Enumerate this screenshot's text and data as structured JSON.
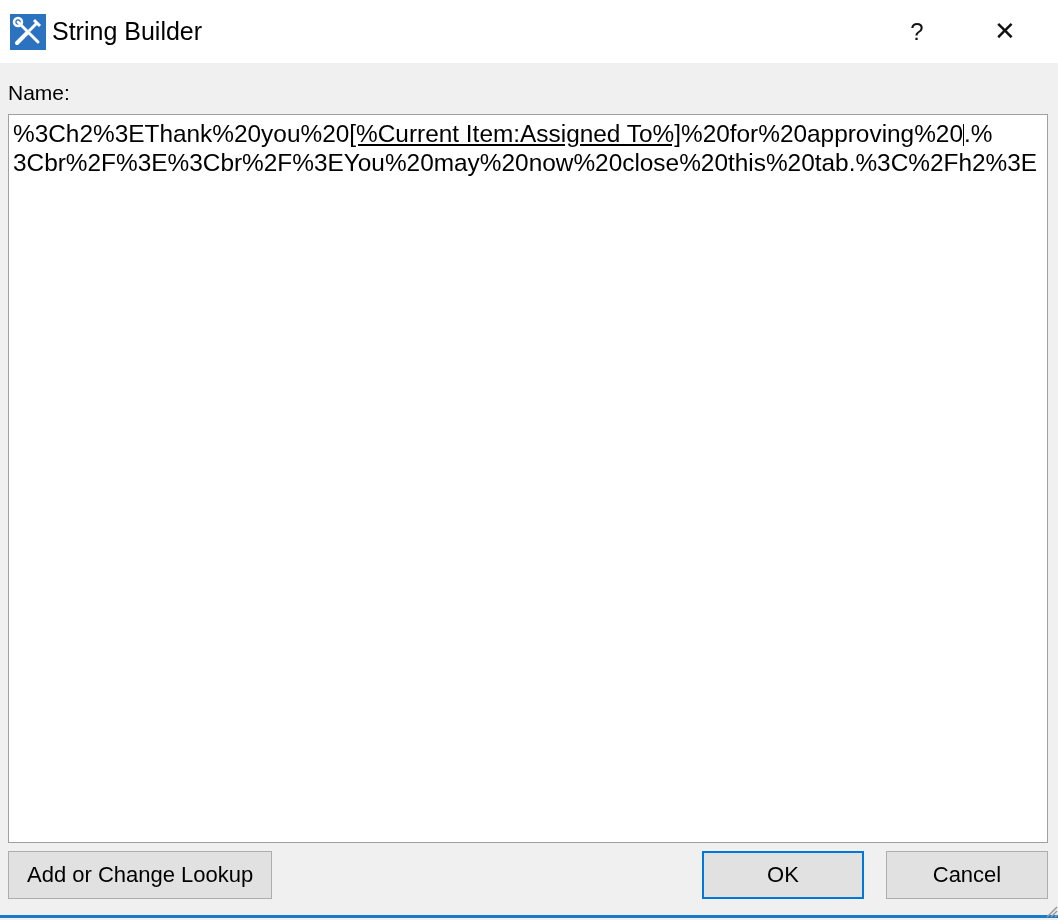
{
  "window": {
    "title": "String Builder",
    "help": "?",
    "close": "✕"
  },
  "name_label": "Name:",
  "editor": {
    "lines": [
      [
        {
          "kind": "plain",
          "text": "%3Ch2%3EThank%20you%20"
        },
        {
          "kind": "lookup",
          "text": "[%Current Item:Assigned To%]"
        },
        {
          "kind": "plain",
          "text": "%20for%20approving%20"
        },
        {
          "kind": "caret"
        },
        {
          "kind": "plain",
          "text": ".%"
        }
      ],
      [
        {
          "kind": "plain",
          "text": "3Cbr%2F%3E%3Cbr%2F%3EYou%20may%20now%20close%20this%20tab.%3C%2Fh2%3E"
        }
      ]
    ]
  },
  "buttons": [
    {
      "label": "Add or Change Lookup",
      "kind": "left",
      "default": false
    },
    {
      "label": "OK",
      "kind": "right",
      "default": true
    },
    {
      "label": "Cancel",
      "kind": "right",
      "default": false
    }
  ]
}
